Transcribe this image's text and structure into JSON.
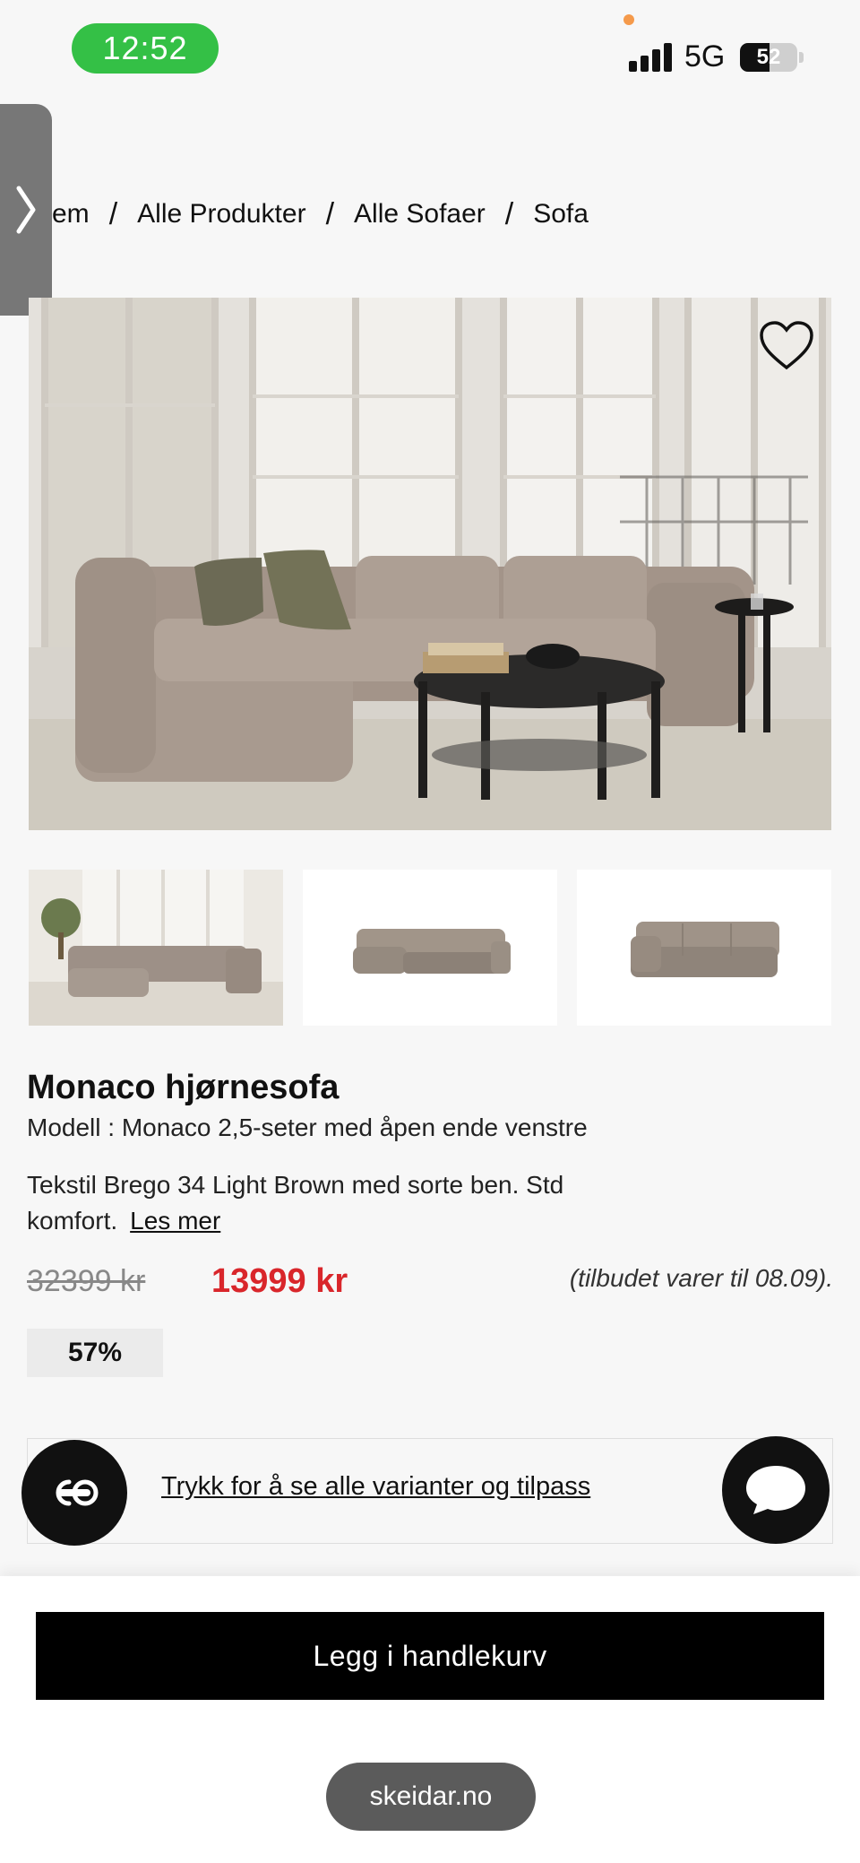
{
  "status_bar": {
    "time": "12:52",
    "network": "5G",
    "battery": "52",
    "battery_level_percent": 52
  },
  "breadcrumb": {
    "items": [
      "em",
      "Alle Produkter",
      "Alle Sofaer",
      "Sofa"
    ],
    "separator": "/"
  },
  "product": {
    "title": "Monaco hjørnesofa",
    "model": "Modell : Monaco 2,5-seter med åpen ende venstre",
    "description_line1": "Tekstil Brego 34 Light Brown med sorte ben. Std",
    "description_line2": "komfort.",
    "read_more": "Les mer",
    "old_price": "32399 kr",
    "new_price": "13999 kr",
    "offer_note": "(tilbudet varer til 08.09).",
    "discount": "57%",
    "variants_link": "Trykk for å se alle varianter og tilpass"
  },
  "actions": {
    "add_to_cart": "Legg i handlekurv"
  },
  "browser": {
    "url": "skeidar.no"
  },
  "icons": {
    "side_tab": "chevron-right-icon",
    "favorite": "heart-icon",
    "left_fab": "co-browse-icon",
    "right_fab": "chat-bubble-icon",
    "signal": "cellular-signal-icon"
  },
  "colors": {
    "price_red": "#d9262b",
    "time_green": "#34c046",
    "button_black": "#000000",
    "background": "#f7f7f7"
  }
}
